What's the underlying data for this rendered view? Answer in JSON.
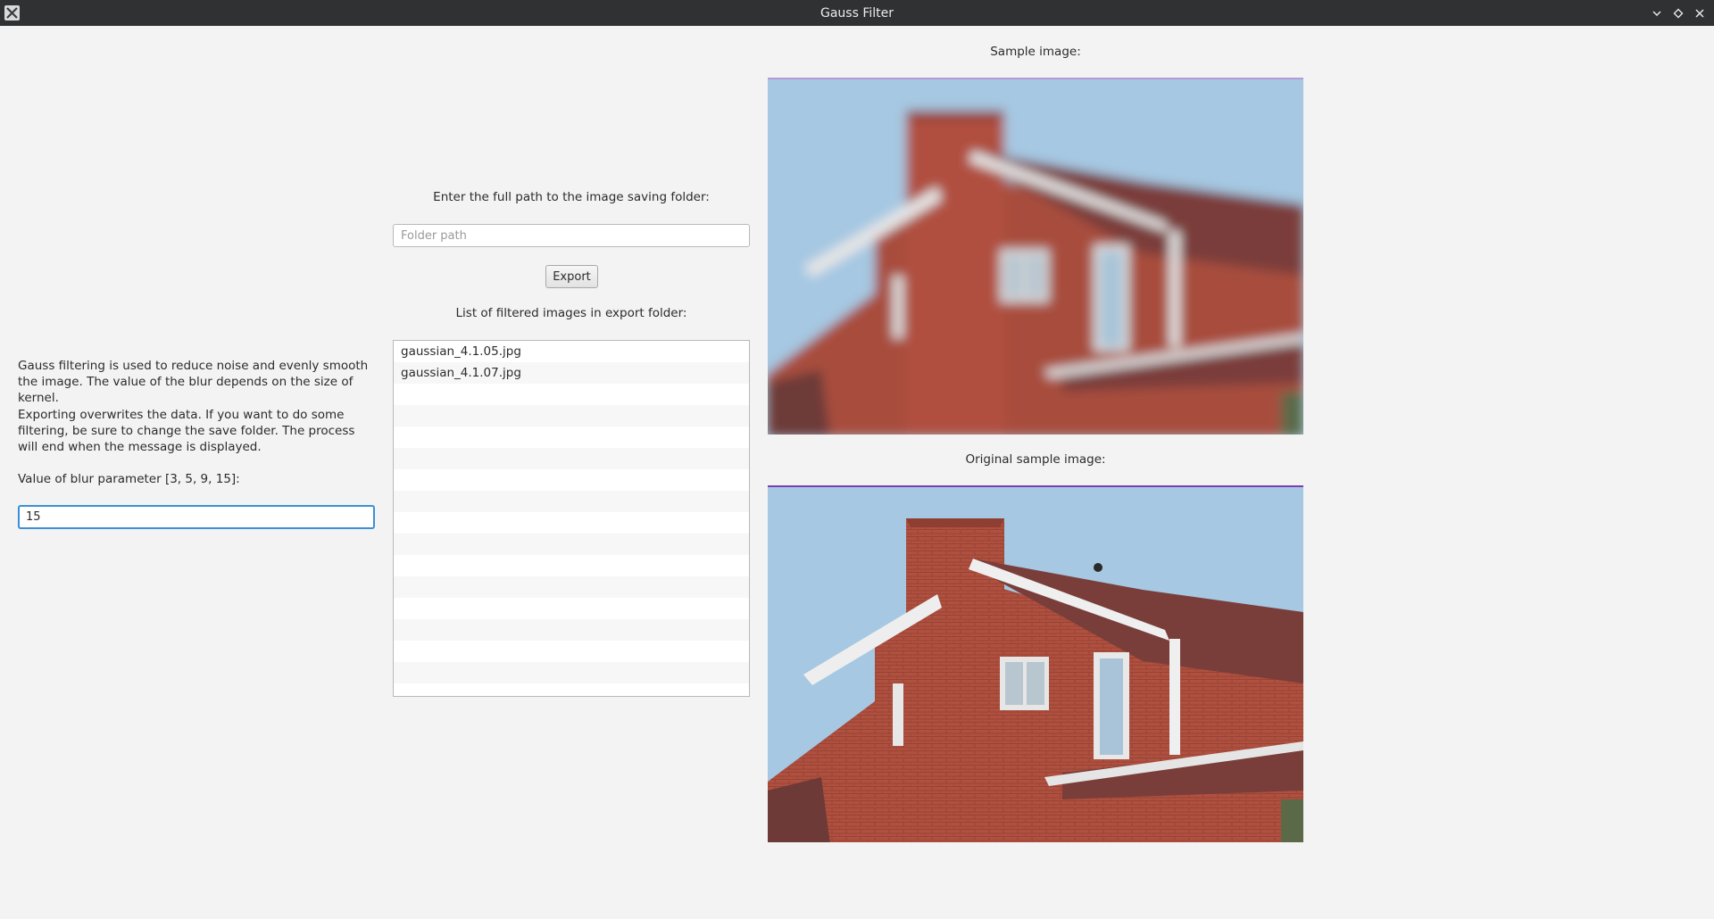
{
  "window": {
    "title": "Gauss Filter"
  },
  "left_panel": {
    "description_1": "Gauss filtering is used to reduce noise and evenly smooth the image. The value of the blur depends on the size of kernel.",
    "description_2": "Exporting overwrites the data. If you want to do some filtering, be sure to change the save folder. The process will end when the message is displayed.",
    "blur_label": "Value of blur parameter [3, 5, 9, 15]:",
    "blur_value": "15"
  },
  "export_panel": {
    "folder_label": "Enter the full path to the image saving folder:",
    "folder_placeholder": "Folder path",
    "export_button": "Export",
    "list_label": "List of filtered images in export folder:",
    "files": [
      "gaussian_4.1.05.jpg",
      "gaussian_4.1.07.jpg"
    ]
  },
  "images": {
    "sample_label": "Sample image:",
    "original_label": "Original sample image:"
  },
  "colors": {
    "accent": "#3a8fd8",
    "titlebar": "#2f3133",
    "window_bg": "#f3f3f3"
  }
}
